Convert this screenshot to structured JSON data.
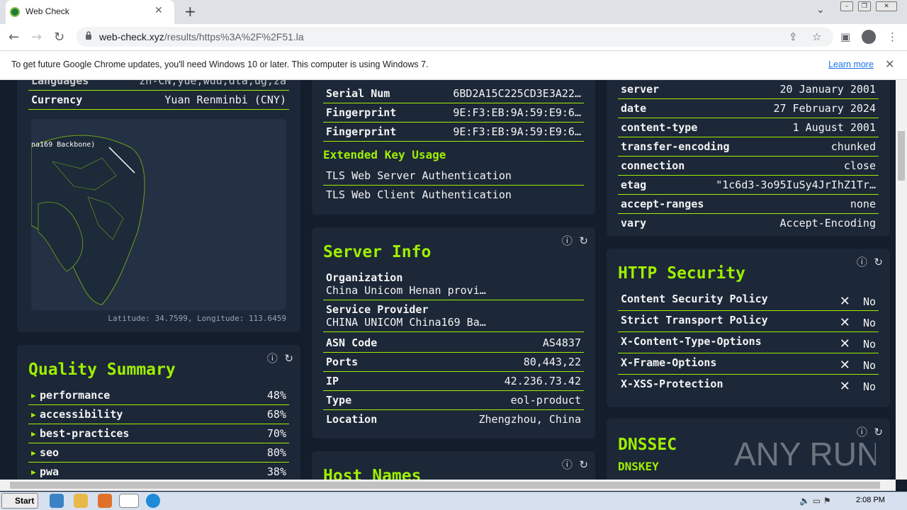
{
  "browser": {
    "tab_title": "Web Check",
    "url_host": "web-check.xyz",
    "url_path": "/results/https%3A%2F%2F51.la",
    "infobar_text": "To get future Google Chrome updates, you'll need Windows 10 or later. This computer is using Windows 7.",
    "infobar_link": "Learn more"
  },
  "location_card": {
    "languages_label": "Languages",
    "languages_value": "zh-CN,yue,wuu,dta,ug,za",
    "currency_label": "Currency",
    "currency_value": "Yuan Renminbi (CNY)",
    "map_label": "na169 Backbone)",
    "coordinates": "Latitude: 34.7599, Longitude: 113.6459"
  },
  "quality_summary": {
    "title": "Quality Summary",
    "items": [
      {
        "name": "performance",
        "value": "48%"
      },
      {
        "name": "accessibility",
        "value": "68%"
      },
      {
        "name": "best-practices",
        "value": "70%"
      },
      {
        "name": "seo",
        "value": "80%"
      },
      {
        "name": "pwa",
        "value": "38%"
      }
    ]
  },
  "ssl_card": {
    "rows": [
      {
        "key": "Serial Num",
        "value": "6BD2A15C225CD3E3A22…"
      },
      {
        "key": "Fingerprint",
        "value": "9E:F3:EB:9A:59:E9:6…"
      },
      {
        "key": "Fingerprint",
        "value": "9E:F3:EB:9A:59:E9:6…"
      }
    ],
    "eku_title": "Extended Key Usage",
    "eku": [
      "TLS Web Server Authentication",
      "TLS Web Client Authentication"
    ]
  },
  "server_info": {
    "title": "Server Info",
    "organization_label": "Organization",
    "organization_value": "China Unicom Henan provi…",
    "provider_label": "Service Provider",
    "provider_value": "CHINA UNICOM China169 Ba…",
    "rows": [
      {
        "key": "ASN Code",
        "value": "AS4837"
      },
      {
        "key": "Ports",
        "value": "80,443,22"
      },
      {
        "key": "IP",
        "value": "42.236.73.42"
      },
      {
        "key": "Type",
        "value": "eol-product"
      },
      {
        "key": "Location",
        "value": "Zhengzhou, China"
      }
    ]
  },
  "host_names": {
    "title": "Host Names"
  },
  "headers_card": {
    "rows": [
      {
        "key": "server",
        "value": "20 January 2001"
      },
      {
        "key": "date",
        "value": "27 February 2024"
      },
      {
        "key": "content-type",
        "value": "1 August 2001"
      },
      {
        "key": "transfer-encoding",
        "value": "chunked"
      },
      {
        "key": "connection",
        "value": "close"
      },
      {
        "key": "etag",
        "value": "\"1c6d3-3o95IuSy4JrIhZ1Tr…"
      },
      {
        "key": "accept-ranges",
        "value": "none"
      },
      {
        "key": "vary",
        "value": "Accept-Encoding"
      }
    ]
  },
  "http_security": {
    "title": "HTTP Security",
    "items": [
      {
        "name": "Content Security Policy",
        "status": "No"
      },
      {
        "name": "Strict Transport Policy",
        "status": "No"
      },
      {
        "name": "X-Content-Type-Options",
        "status": "No"
      },
      {
        "name": "X-Frame-Options",
        "status": "No"
      },
      {
        "name": "X-XSS-Protection",
        "status": "No"
      }
    ]
  },
  "dnssec": {
    "title": "DNSSEC",
    "subtitle": "DNSKEY"
  },
  "watermark": "ANY RUN",
  "taskbar": {
    "start_label": "Start",
    "clock": "2:08 PM"
  },
  "colors": {
    "accent": "#9fef00",
    "card": "#1c2738",
    "page": "#141d2b"
  }
}
